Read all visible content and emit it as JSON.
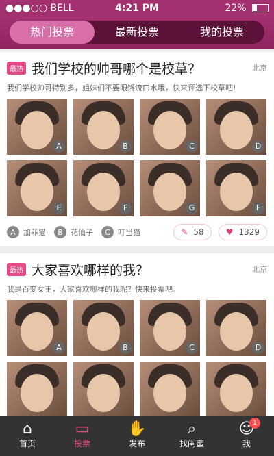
{
  "status": {
    "carrier": "●●●○○ BELL",
    "time": "4:21 PM",
    "battery": "22%"
  },
  "header": {
    "tabs": [
      "热门投票",
      "最新投票",
      "我的投票"
    ]
  },
  "cards": [
    {
      "badge": "最热",
      "title": "我们学校的帅哥哪个是校草？",
      "city": "北京",
      "desc": "我们学校帅哥特别多，姐妹们不要眼馋流口水哦，快来评选下校草吧!",
      "labels": [
        "A",
        "B",
        "C",
        "D",
        "E",
        "F",
        "G",
        "F"
      ],
      "options": [
        {
          "letter": "A",
          "name": "加菲猫"
        },
        {
          "letter": "B",
          "name": "花仙子"
        },
        {
          "letter": "C",
          "name": "叮当猫"
        }
      ],
      "stats": {
        "comments": "58",
        "votes": "1329"
      }
    },
    {
      "badge": "最热",
      "title": "大家喜欢哪样的我？",
      "city": "北京",
      "desc": "我是百变女王，大家喜欢哪样的我呢？快来投票吧。",
      "labels": [
        "A",
        "B",
        "C",
        "D",
        "",
        "",
        "",
        ""
      ]
    }
  ],
  "tabbar": [
    {
      "label": "首页",
      "icon": "⌂"
    },
    {
      "label": "投票",
      "icon": "▭"
    },
    {
      "label": "发布",
      "icon": "✋"
    },
    {
      "label": "找闺蜜",
      "icon": "⌕"
    },
    {
      "label": "我",
      "icon": "☺",
      "badge": "1"
    }
  ]
}
